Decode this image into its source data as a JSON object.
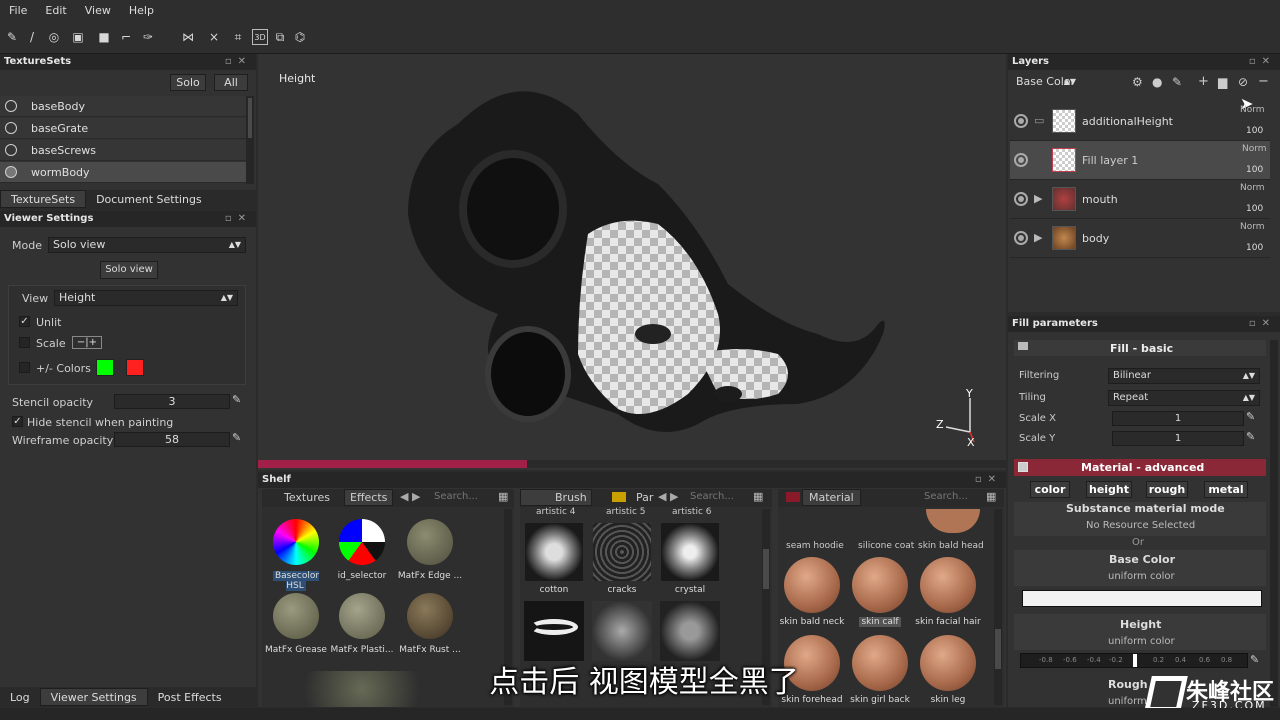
{
  "menu": [
    "File",
    "Edit",
    "View",
    "Help"
  ],
  "texturesets": {
    "title": "TextureSets",
    "solo": "Solo",
    "all": "All",
    "items": [
      "baseBody",
      "baseGrate",
      "baseScrews",
      "wormBody"
    ],
    "tabs": [
      "TextureSets",
      "Document Settings"
    ]
  },
  "viewer": {
    "title": "Viewer Settings",
    "mode_label": "Mode",
    "mode_value": "Solo view",
    "solo_view_btn": "Solo view",
    "view_label": "View",
    "view_value": "Height",
    "unlit": "Unlit",
    "scale": "Scale",
    "colors": "+/- Colors",
    "colors_plus": "#00ff00",
    "colors_minus": "#ff2020",
    "stencil_label": "Stencil opacity",
    "stencil_value": "3",
    "hide_stencil": "Hide stencil when painting",
    "wireframe_label": "Wireframe opacity",
    "wireframe_value": "58"
  },
  "bottom_tabs": [
    "Log",
    "Viewer Settings",
    "Post Effects"
  ],
  "viewport": {
    "label": "Height",
    "axis_y": "Y",
    "axis_z": "Z",
    "axis_x": "X",
    "progress": 0.36
  },
  "shelf": {
    "title": "Shelf",
    "p1": {
      "tabs": [
        "Textures",
        "Effects"
      ],
      "search": "Search...",
      "items": [
        "Basecolor HSL",
        "id_selector",
        "MatFx Edge ...",
        "MatFx Grease",
        "MatFx Plasti...",
        "MatFx Rust ..."
      ]
    },
    "p2": {
      "tabs": [
        "Brush",
        "Par"
      ],
      "search": "Search...",
      "top_items": [
        "artistic 4",
        "artistic 5",
        "artistic 6"
      ],
      "items": [
        "cotton",
        "cracks",
        "crystal"
      ]
    },
    "p3": {
      "tab": "Material",
      "search": "Search...",
      "top_items": [
        "seam hoodie",
        "silicone coat",
        "skin bald head"
      ],
      "items": [
        "skin bald neck",
        "skin calf",
        "skin facial hair"
      ],
      "bottom_items": [
        "skin forehead",
        "skin girl back",
        "skin leg"
      ]
    }
  },
  "layers": {
    "title": "Layers",
    "channel": "Base Color",
    "rows": [
      {
        "name": "additionalHeight",
        "blend": "Norm",
        "opacity": "100"
      },
      {
        "name": "Fill layer 1",
        "blend": "Norm",
        "opacity": "100"
      },
      {
        "name": "mouth",
        "blend": "Norm",
        "opacity": "100"
      },
      {
        "name": "body",
        "blend": "Norm",
        "opacity": "100"
      }
    ]
  },
  "fill": {
    "title": "Fill parameters",
    "section": "Fill - basic",
    "filtering_label": "Filtering",
    "filtering_value": "Bilinear",
    "tiling_label": "Tiling",
    "tiling_value": "Repeat",
    "scalex_label": "Scale X",
    "scalex_value": "1",
    "scaley_label": "Scale Y",
    "scaley_value": "1",
    "material_section": "Material - advanced",
    "channels": [
      "color",
      "height",
      "rough",
      "metal"
    ],
    "substance_mode": "Substance material mode",
    "no_resource": "No Resource Selected",
    "or": "Or",
    "base_color": "Base Color",
    "uniform1": "uniform color",
    "height_label": "Height",
    "uniform2": "uniform color",
    "height_ticks": [
      "-0.8",
      "-0.6",
      "-0.4",
      "-0.2",
      "0.2",
      "0.4",
      "0.6",
      "0.8"
    ],
    "rough_label": "Rough",
    "uniform3": "uniform"
  },
  "subtitle": "点击后 视图模型全黑了",
  "watermark": {
    "brand": "朱峰社区",
    "url": "ZF3D.COM"
  }
}
